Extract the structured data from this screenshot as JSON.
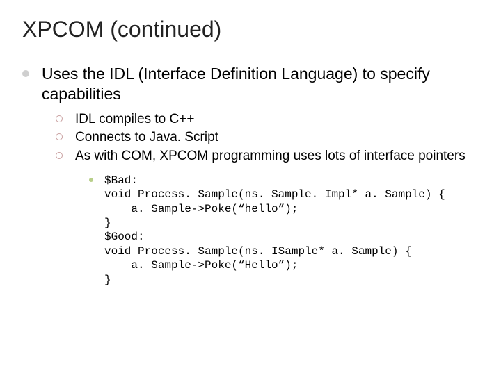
{
  "title": "XPCOM (continued)",
  "level1": "Uses the IDL (Interface Definition Language) to specify capabilities",
  "level2": [
    "IDL compiles to C++",
    "Connects to Java. Script",
    "As with COM, XPCOM programming uses lots of interface pointers"
  ],
  "code": {
    "l1": "$Bad:",
    "l2": "void Process. Sample(ns. Sample. Impl* a. Sample) {",
    "l3": "    a. Sample->Poke(“hello”);",
    "l4": "}",
    "l5": "$Good:",
    "l6": "void Process. Sample(ns. ISample* a. Sample) {",
    "l7": "    a. Sample->Poke(“Hello”);",
    "l8": "}"
  }
}
